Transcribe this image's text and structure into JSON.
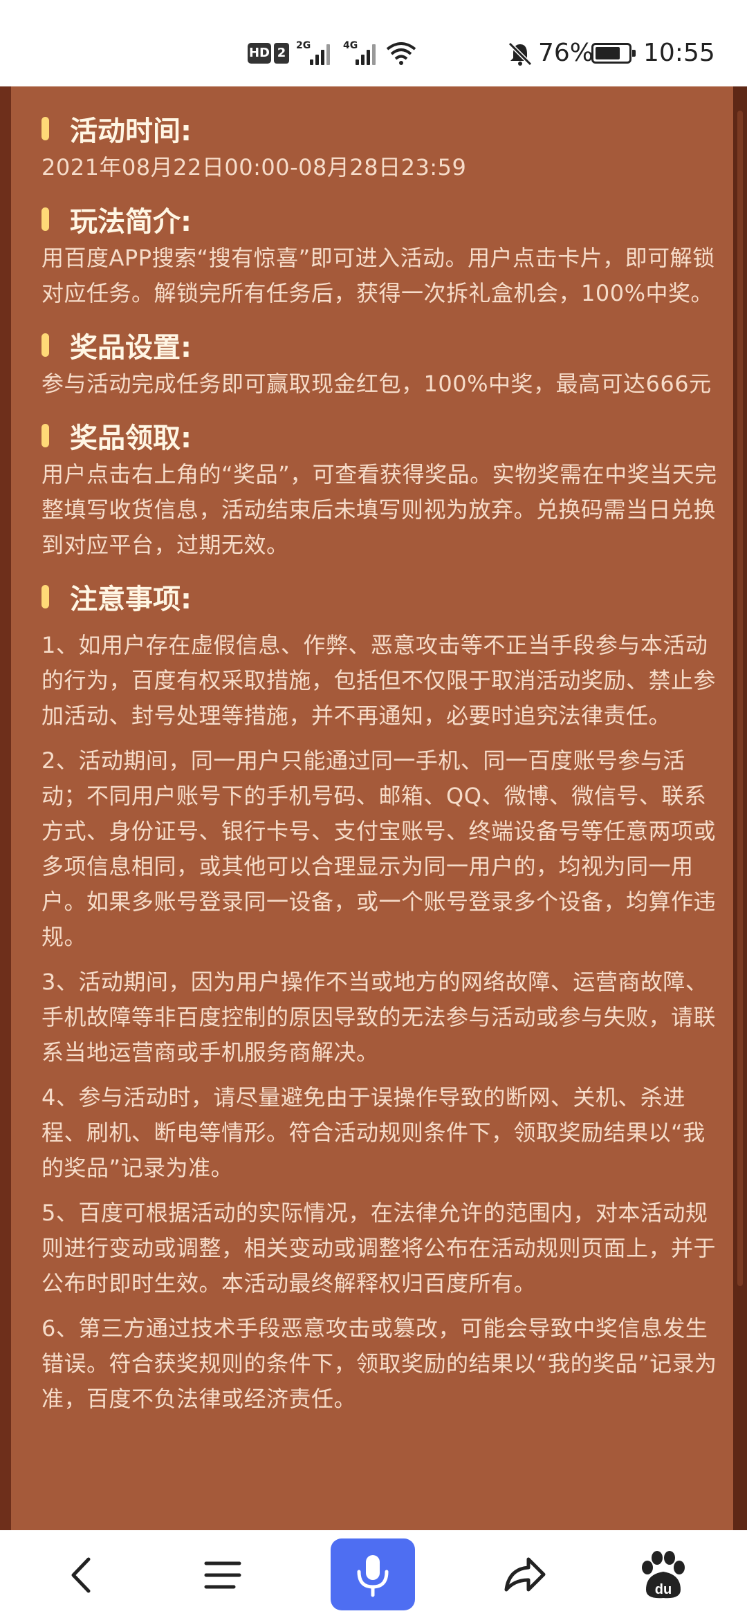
{
  "status_bar": {
    "hd": "HD",
    "sim2": "2",
    "net1": "2G",
    "net2": "4G",
    "battery_pct": "76%",
    "battery_level": 0.76,
    "time": "10:55",
    "icons": [
      "hd-icon",
      "signal-icon",
      "wifi-icon",
      "bell-muted-icon",
      "battery-icon"
    ]
  },
  "sections": [
    {
      "title": "活动时间:",
      "paragraphs": [
        "2021年08月22日00:00-08月28日23:59"
      ]
    },
    {
      "title": "玩法简介:",
      "paragraphs": [
        "用百度APP搜索“搜有惊喜”即可进入活动。用户点击卡片，即可解锁对应任务。解锁完所有任务后，获得一次拆礼盒机会，100%中奖。"
      ]
    },
    {
      "title": "奖品设置:",
      "paragraphs": [
        "参与活动完成任务即可赢取现金红包，100%中奖，最高可达666元"
      ]
    },
    {
      "title": "奖品领取:",
      "paragraphs": [
        "用户点击右上角的“奖品”，可查看获得奖品。实物奖需在中奖当天完整填写收货信息，活动结束后未填写则视为放弃。兑换码需当日兑换到对应平台，过期无效。"
      ]
    },
    {
      "title": "注意事项:",
      "paragraphs": [
        "1、如用户存在虚假信息、作弊、恶意攻击等不正当手段参与本活动的行为，百度有权采取措施，包括但不仅限于取消活动奖励、禁止参加活动、封号处理等措施，并不再通知，必要时追究法律责任。",
        "2、活动期间，同一用户只能通过同一手机、同一百度账号参与活动；不同用户账号下的手机号码、邮箱、QQ、微博、微信号、联系方式、身份证号、银行卡号、支付宝账号、终端设备号等任意两项或多项信息相同，或其他可以合理显示为同一用户的，均视为同一用户。如果多账号登录同一设备，或一个账号登录多个设备，均算作违规。",
        "3、活动期间，因为用户操作不当或地方的网络故障、运营商故障、手机故障等非百度控制的原因导致的无法参与活动或参与失败，请联系当地运营商或手机服务商解决。",
        "4、参与活动时，请尽量避免由于误操作导致的断网、关机、杀进程、刷机、断电等情形。符合活动规则条件下，领取奖励结果以“我的奖品”记录为准。",
        "5、百度可根据活动的实际情况，在法律允许的范围内，对本活动规则进行变动或调整，相关变动或调整将公布在活动规则页面上，并于公布时即时生效。本活动最终解释权归百度所有。",
        "6、第三方通过技术手段恶意攻击或篡改，可能会导致中奖信息发生错误。符合获奖规则的条件下，领取奖励的结果以“我的奖品”记录为准，百度不负法律或经济责任。"
      ]
    }
  ],
  "bottom_nav": {
    "items": [
      "back-icon",
      "menu-icon",
      "voice-mic-icon",
      "share-icon",
      "baidu-paw-icon"
    ]
  },
  "colors": {
    "panel": "#a55a3a",
    "outer": "#6e2f1b",
    "heading": "#fff6e4",
    "body_text": "#f6dcc9",
    "accent_bar": "#ffd977",
    "voice_button": "#4e6ef2"
  }
}
